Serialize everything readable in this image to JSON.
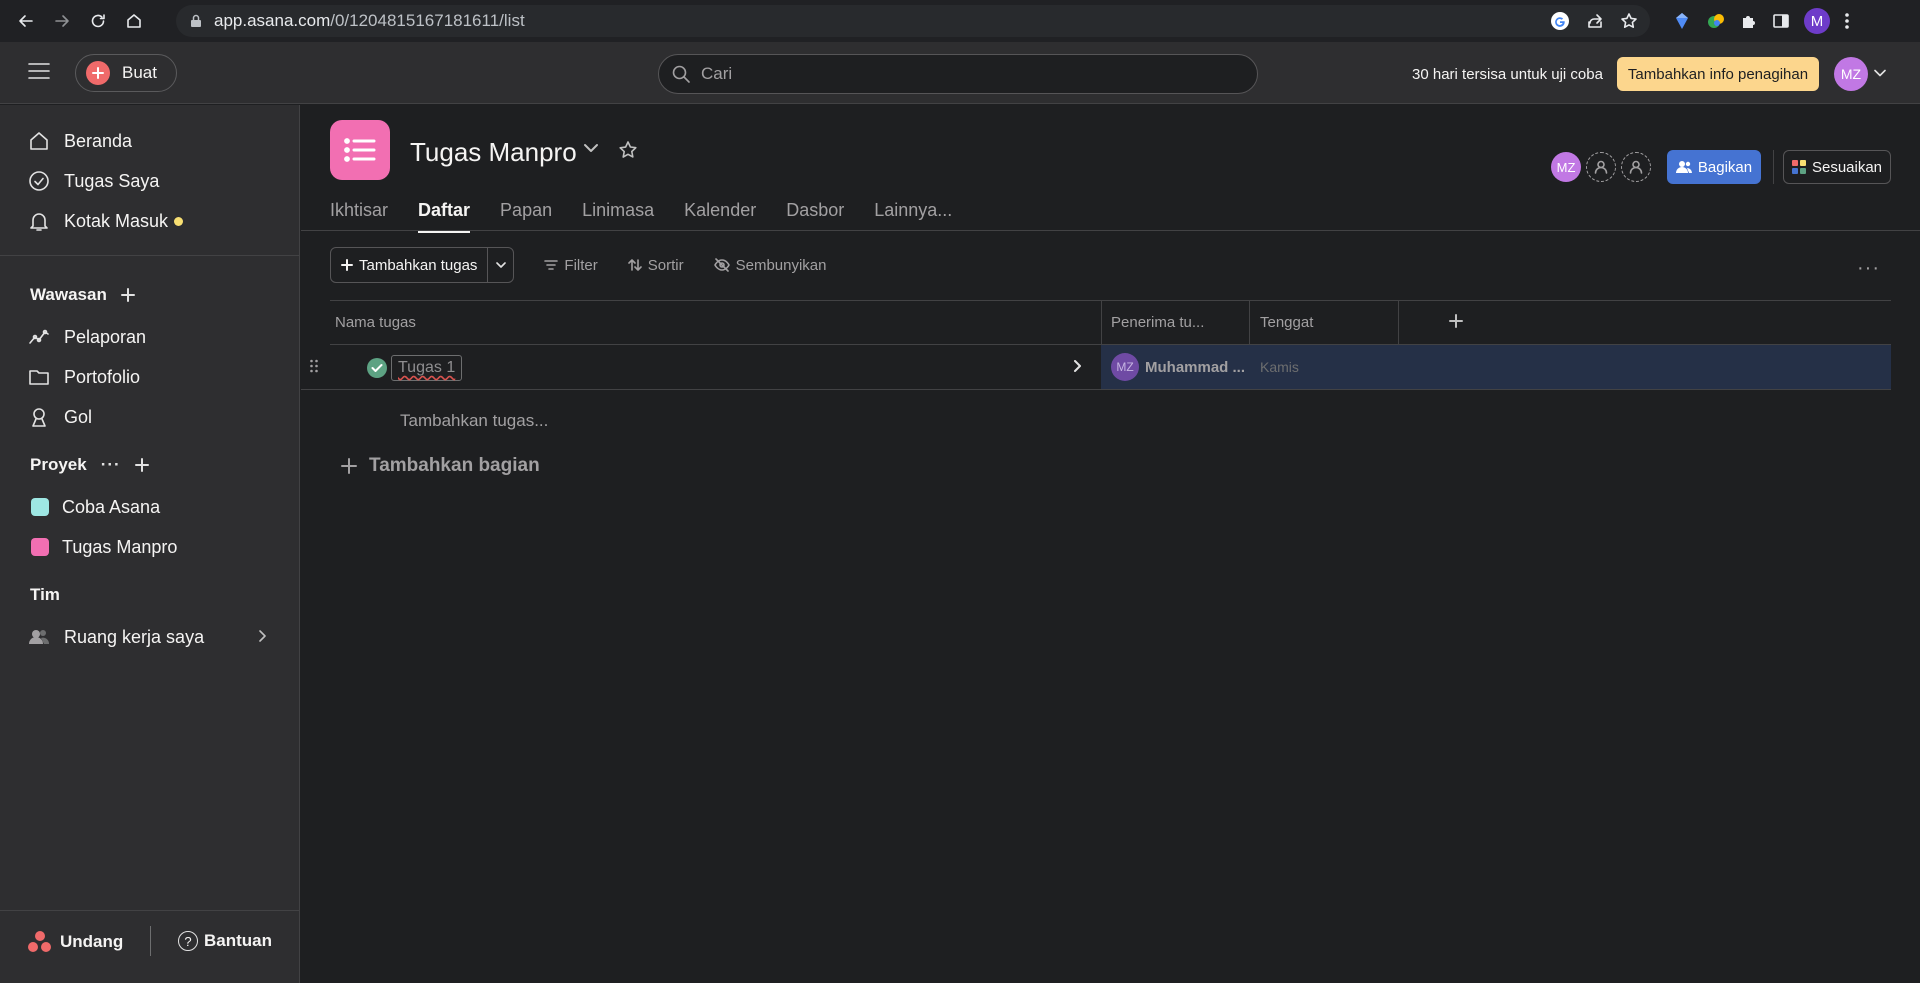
{
  "browser": {
    "url_domain": "app.asana.com",
    "url_path": "/0/1204815167181611/list",
    "profile_initial": "M"
  },
  "topbar": {
    "create_label": "Buat",
    "search_placeholder": "Cari",
    "trial_text": "30 hari tersisa untuk uji coba",
    "billing_label": "Tambahkan info penagihan",
    "user_initials": "MZ"
  },
  "sidebar": {
    "nav": [
      {
        "label": "Beranda",
        "icon": "home-icon"
      },
      {
        "label": "Tugas Saya",
        "icon": "check-circle-icon"
      },
      {
        "label": "Kotak Masuk",
        "icon": "bell-icon"
      }
    ],
    "insights_heading": "Wawasan",
    "insights": [
      {
        "label": "Pelaporan",
        "icon": "chart-line-icon"
      },
      {
        "label": "Portofolio",
        "icon": "folder-icon"
      },
      {
        "label": "Gol",
        "icon": "person-goal-icon"
      }
    ],
    "projects_heading": "Proyek",
    "projects": [
      {
        "label": "Coba Asana",
        "color": "#9ee7e3"
      },
      {
        "label": "Tugas Manpro",
        "color": "#f26fb2"
      }
    ],
    "team_heading": "Tim",
    "team_item": "Ruang kerja saya",
    "invite_label": "Undang",
    "help_label": "Bantuan"
  },
  "project": {
    "title": "Tugas Manpro",
    "icon_color": "#f26fb2",
    "tabs": [
      "Ikhtisar",
      "Daftar",
      "Papan",
      "Linimasa",
      "Kalender",
      "Dasbor",
      "Lainnya..."
    ],
    "active_tab": "Daftar",
    "member_initials": "MZ",
    "share_label": "Bagikan",
    "customize_label": "Sesuaikan"
  },
  "toolbar": {
    "add_task_label": "Tambahkan tugas",
    "filter_label": "Filter",
    "sort_label": "Sortir",
    "hide_label": "Sembunyikan"
  },
  "table": {
    "columns": [
      "Nama tugas",
      "Penerima tu...",
      "Tenggat"
    ],
    "rows": [
      {
        "name": "Tugas 1",
        "assignee_initials": "MZ",
        "assignee": "Muhammad ...",
        "due": "Kamis"
      }
    ],
    "add_task_row": "Tambahkan tugas...",
    "add_section": "Tambahkan bagian"
  }
}
